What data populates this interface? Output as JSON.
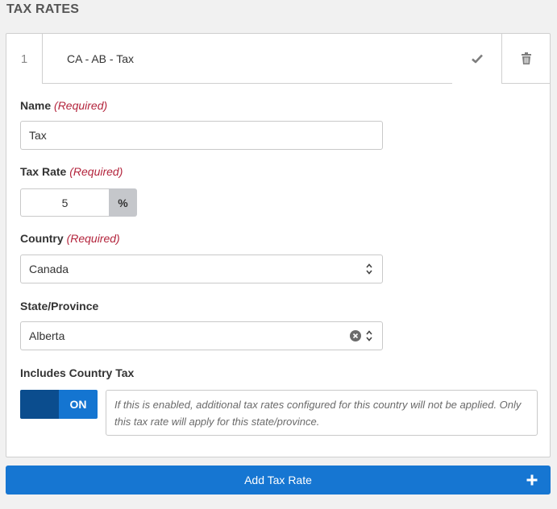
{
  "section_title": "TAX RATES",
  "rate_card": {
    "index": "1",
    "summary_name": "CA - AB - Tax",
    "check_icon": "check-icon",
    "delete_icon": "trash-icon"
  },
  "fields": {
    "name": {
      "label": "Name",
      "required": "(Required)",
      "value": "Tax"
    },
    "tax_rate": {
      "label": "Tax Rate",
      "required": "(Required)",
      "value": "5",
      "unit": "%"
    },
    "country": {
      "label": "Country",
      "required": "(Required)",
      "value": "Canada"
    },
    "state": {
      "label": "State/Province",
      "value": "Alberta"
    },
    "includes_country_tax": {
      "label": "Includes Country Tax",
      "toggle_label": "ON",
      "enabled": true,
      "help_text": "If this is enabled, additional tax rates configured for this country will not be applied. Only this tax rate will apply for this state/province."
    }
  },
  "add_button": {
    "label": "Add Tax Rate",
    "icon": "plus-icon"
  },
  "colors": {
    "accent": "#1676d2",
    "toggle_dark": "#0b4d8e",
    "required": "#b3243c"
  }
}
